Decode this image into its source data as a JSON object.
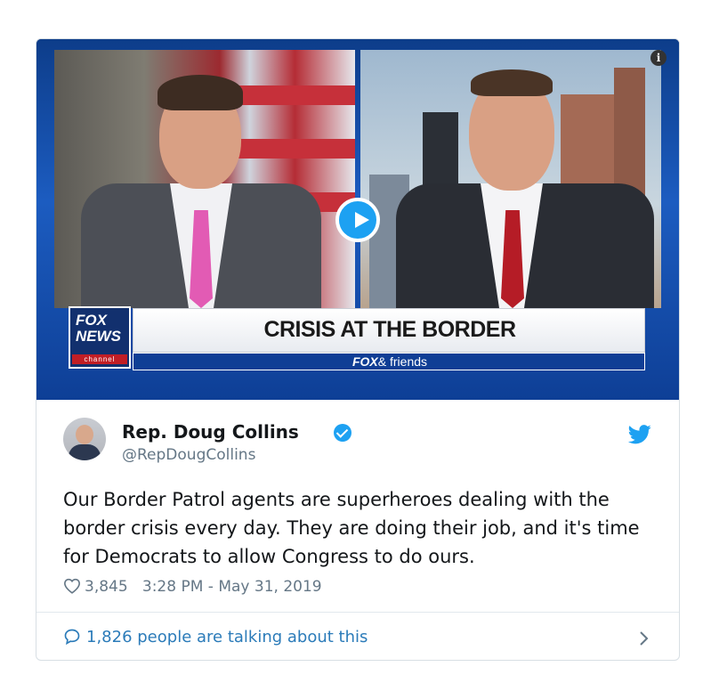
{
  "media": {
    "banner_headline": "CRISIS AT THE BORDER",
    "network_logo_line1": "FOX",
    "network_logo_line2": "NEWS",
    "network_logo_line3": "channel",
    "show_brand": "FOX",
    "show_name": "& friends",
    "info_glyph": "i"
  },
  "tweet": {
    "author_name": "Rep. Doug Collins",
    "author_handle": "@RepDougCollins",
    "text": "Our Border Patrol agents are superheroes dealing with the border crisis every day. They are doing their job, and it's time for Democrats to allow Congress to do ours.",
    "likes": "3,845",
    "timestamp": "3:28 PM - May 31, 2019",
    "conversation": "1,826 people are talking about this"
  },
  "icons": {
    "play": "play-icon",
    "info": "info-icon",
    "verified": "verified-badge-icon",
    "bird": "twitter-bird-icon",
    "heart": "heart-icon",
    "comment": "comment-bubble-icon",
    "chevron": "chevron-right-icon"
  },
  "colors": {
    "twitter_blue": "#1da1f2",
    "link_blue": "#2b7bb9",
    "muted_text": "#657786",
    "fox_blue": "#0f3e95",
    "fox_red": "#c11e25"
  }
}
